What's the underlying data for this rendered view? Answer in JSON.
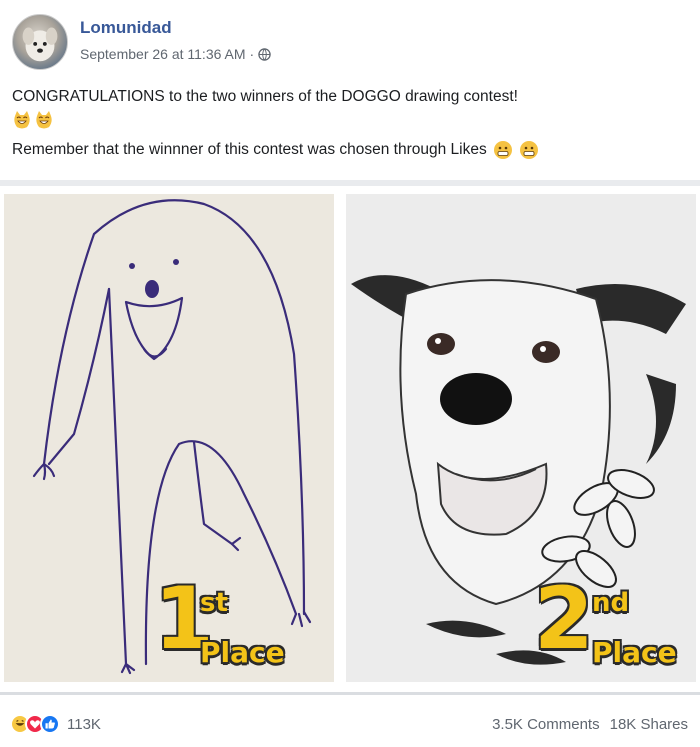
{
  "post": {
    "author": "Lomunidad",
    "timestamp": "September 26 at 11:36 AM",
    "separator": "·",
    "audience_icon": "globe-icon",
    "line1": "CONGRATULATIONS to the two winners of the DOGGO drawing contest!",
    "line2": "Remember that the winnner of this contest was chosen through Likes",
    "emojis_line1": [
      "cat-grin-emoji",
      "cat-grin-emoji"
    ],
    "emojis_line2": [
      "grimace-emoji",
      "grimace-emoji"
    ]
  },
  "images": {
    "first": {
      "number": "1",
      "suffix": "st",
      "word": "Place",
      "description_icon": "childlike-dog-drawing"
    },
    "second": {
      "number": "2",
      "suffix": "nd",
      "word": "Place",
      "description_icon": "realistic-dog-sketch"
    }
  },
  "footer": {
    "reaction_icons": [
      "haha-icon",
      "love-icon",
      "like-icon"
    ],
    "reaction_count": "113K",
    "comments": "3.5K Comments",
    "shares": "18K Shares"
  },
  "colors": {
    "author": "#385898",
    "place_text": "#f3c318",
    "meta": "#606770"
  }
}
